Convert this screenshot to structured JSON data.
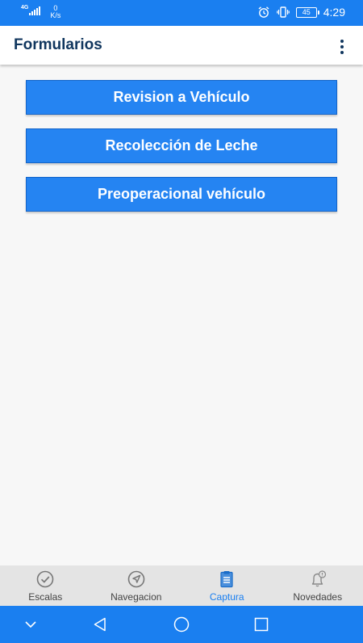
{
  "status_bar": {
    "network_type": "4G",
    "speed_value": "0",
    "speed_unit": "K/s",
    "battery": "45",
    "time": "4:29",
    "icons": [
      "signal-icon",
      "alarm-icon",
      "vibrate-icon",
      "battery-icon"
    ]
  },
  "app_bar": {
    "title": "Formularios",
    "menu_icon": "more-vert-icon"
  },
  "forms": [
    {
      "label": "Revision a Vehículo"
    },
    {
      "label": "Recolección de Leche"
    },
    {
      "label": "Preoperacional vehículo"
    }
  ],
  "bottom_nav": {
    "active_index": 2,
    "items": [
      {
        "label": "Escalas",
        "icon": "check-circle-icon"
      },
      {
        "label": "Navegacion",
        "icon": "navigation-icon"
      },
      {
        "label": "Captura",
        "icon": "clipboard-icon"
      },
      {
        "label": "Novedades",
        "icon": "notification-bell-icon"
      }
    ]
  },
  "system_nav": [
    "collapse-icon",
    "back-icon",
    "home-icon",
    "recents-icon"
  ],
  "colors": {
    "primary": "#1a7ff0",
    "button": "#2584f2",
    "title": "#10365e",
    "nav_background": "#e4e4e4",
    "nav_active": "#1a7ff0",
    "nav_inactive": "#444444"
  }
}
